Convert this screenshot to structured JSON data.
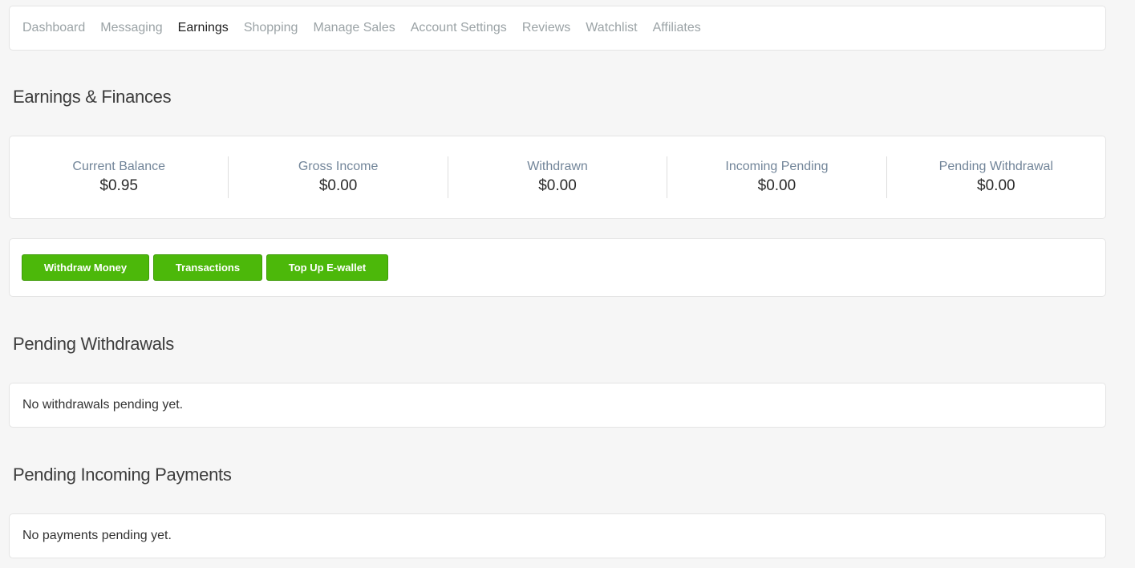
{
  "nav": {
    "items": [
      {
        "label": "Dashboard",
        "active": false
      },
      {
        "label": "Messaging",
        "active": false
      },
      {
        "label": "Earnings",
        "active": true
      },
      {
        "label": "Shopping",
        "active": false
      },
      {
        "label": "Manage Sales",
        "active": false
      },
      {
        "label": "Account Settings",
        "active": false
      },
      {
        "label": "Reviews",
        "active": false
      },
      {
        "label": "Watchlist",
        "active": false
      },
      {
        "label": "Affiliates",
        "active": false
      }
    ]
  },
  "earnings": {
    "title": "Earnings & Finances",
    "stats": [
      {
        "label": "Current Balance",
        "value": "$0.95"
      },
      {
        "label": "Gross Income",
        "value": "$0.00"
      },
      {
        "label": "Withdrawn",
        "value": "$0.00"
      },
      {
        "label": "Incoming Pending",
        "value": "$0.00"
      },
      {
        "label": "Pending Withdrawal",
        "value": "$0.00"
      }
    ]
  },
  "actions": {
    "withdraw_label": "Withdraw Money",
    "transactions_label": "Transactions",
    "topup_label": "Top Up E-wallet"
  },
  "pending_withdrawals": {
    "title": "Pending Withdrawals",
    "empty_text": "No withdrawals pending yet."
  },
  "pending_payments": {
    "title": "Pending Incoming Payments",
    "empty_text": "No payments pending yet."
  },
  "colors": {
    "background": "#f6f6f6",
    "button_green": "#4cb80a",
    "nav_inactive": "#9ba3a6",
    "nav_active": "#1e1e1e",
    "stat_label": "#728599"
  }
}
